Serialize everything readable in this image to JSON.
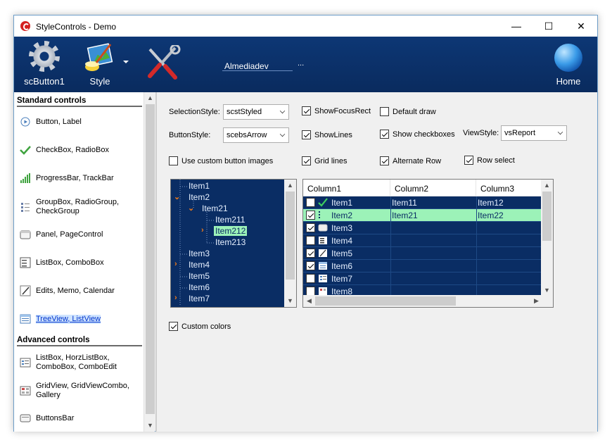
{
  "window": {
    "title": "StyleControls - Demo"
  },
  "titlebar_buttons": {
    "minimize": "—",
    "maximize": "☐",
    "close": "✕"
  },
  "toolbar": {
    "button1_label": "scButton1",
    "style_label": "Style",
    "edit_text": "Almediadev",
    "edit_ellipsis": "...",
    "home_label": "Home"
  },
  "sidebar": {
    "standard_header": "Standard controls",
    "advanced_header": "Advanced controls",
    "standard_items": [
      {
        "label": "Button, Label",
        "icon": "play-circle-icon"
      },
      {
        "label": "CheckBox, RadioBox",
        "icon": "checkmark-icon"
      },
      {
        "label": "ProgressBar, TrackBar",
        "icon": "signal-bars-icon"
      },
      {
        "label": "GroupBox, RadioGroup,\nCheckGroup",
        "icon": "group-list-icon"
      },
      {
        "label": "Panel, PageControl",
        "icon": "panel-icon"
      },
      {
        "label": "ListBox, ComboBox",
        "icon": "listbox-icon"
      },
      {
        "label": "Edits, Memo, Calendar",
        "icon": "edit-icon"
      },
      {
        "label": "TreeView, ListView",
        "icon": "treeview-icon"
      }
    ],
    "advanced_items": [
      {
        "label": "ListBox, HorzListBox,\nComboBox, ComboEdit",
        "icon": "listbox-adv-icon"
      },
      {
        "label": "GridView, GridViewCombo,\nGallery",
        "icon": "grid-icon"
      },
      {
        "label": "ButtonsBar",
        "icon": "buttonsbar-icon"
      }
    ]
  },
  "options": {
    "selection_style_label": "SelectionStyle:",
    "selection_style_value": "scstStyled",
    "button_style_label": "ButtonStyle:",
    "button_style_value": "scebsArrow",
    "view_style_label": "ViewStyle:",
    "view_style_value": "vsReport",
    "show_focus_rect": "ShowFocusRect",
    "default_draw": "Default draw",
    "show_lines": "ShowLines",
    "show_checkboxes": "Show checkboxes",
    "use_custom_images": "Use custom button images",
    "grid_lines": "Grid lines",
    "alternate_row": "Alternate Row",
    "row_select": "Row select",
    "custom_colors": "Custom colors"
  },
  "tree": {
    "nodes": [
      {
        "label": "Item1",
        "level": 0,
        "arrow": ""
      },
      {
        "label": "Item2",
        "level": 0,
        "arrow": "down"
      },
      {
        "label": "Item21",
        "level": 1,
        "arrow": "down"
      },
      {
        "label": "Item211",
        "level": 2,
        "arrow": ""
      },
      {
        "label": "Item212",
        "level": 2,
        "arrow": "right",
        "selected": true
      },
      {
        "label": "Item213",
        "level": 2,
        "arrow": ""
      },
      {
        "label": "Item3",
        "level": 0,
        "arrow": ""
      },
      {
        "label": "Item4",
        "level": 0,
        "arrow": "right"
      },
      {
        "label": "Item5",
        "level": 0,
        "arrow": ""
      },
      {
        "label": "Item6",
        "level": 0,
        "arrow": ""
      },
      {
        "label": "Item7",
        "level": 0,
        "arrow": "right"
      }
    ]
  },
  "listview": {
    "columns": [
      "Column1",
      "Column2",
      "Column3"
    ],
    "rows": [
      {
        "c1": "Item1",
        "c2": "Item11",
        "c3": "Item12",
        "checked": false,
        "icon": "checkmark-icon"
      },
      {
        "c1": "Item2",
        "c2": "Item21",
        "c3": "Item22",
        "checked": true,
        "selected": true,
        "icon": "list-icon"
      },
      {
        "c1": "Item3",
        "c2": "",
        "c3": "",
        "checked": true,
        "icon": "panel-icon"
      },
      {
        "c1": "Item4",
        "c2": "",
        "c3": "",
        "checked": false,
        "icon": "listbox-icon"
      },
      {
        "c1": "Item5",
        "c2": "",
        "c3": "",
        "checked": true,
        "icon": "edit-icon"
      },
      {
        "c1": "Item6",
        "c2": "",
        "c3": "",
        "checked": true,
        "icon": "treeview-icon"
      },
      {
        "c1": "Item7",
        "c2": "",
        "c3": "",
        "checked": false,
        "icon": "listbox-adv-icon"
      },
      {
        "c1": "Item8",
        "c2": "",
        "c3": "",
        "checked": false,
        "icon": "grid-icon"
      }
    ]
  }
}
